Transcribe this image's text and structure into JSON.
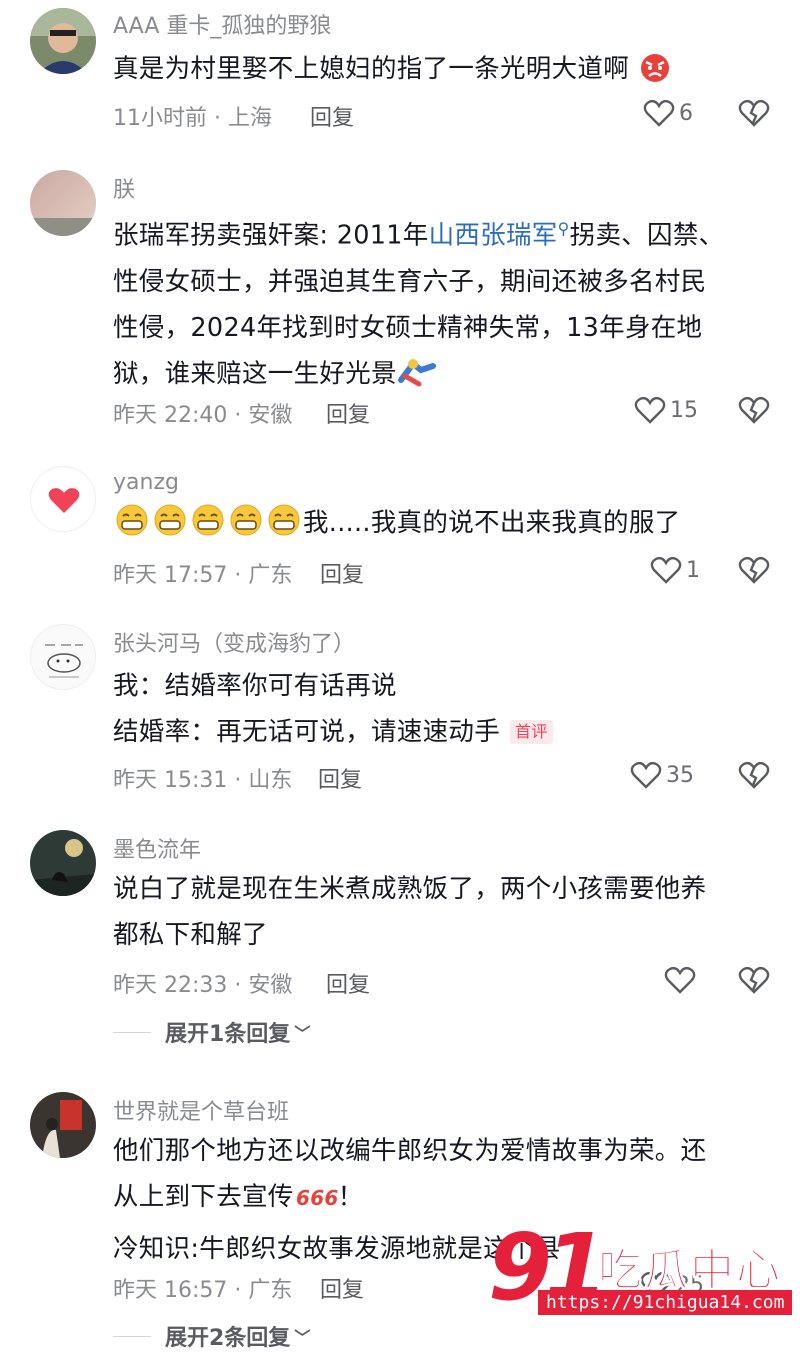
{
  "comments": [
    {
      "username": "AAA 重卡_孤独的野狼",
      "lines": [
        "真是为村里娶不上媳妇的指了一条光明大道啊"
      ],
      "time": "11小时前 · 上海",
      "reply_label": "回复",
      "likes": "6"
    },
    {
      "username": "朕",
      "lines_prefix": "张瑞军拐卖强奸案: 2011年",
      "link_text": "山西张瑞军",
      "lines_suffix": "拐卖、囚禁、",
      "line2": "性侵女硕士，并强迫其生育六子，期间还被多名村民",
      "line3": "性侵，2024年找到时女硕士精神失常，13年身在地",
      "line4": "狱，谁来赔这一生好光景",
      "time": "昨天 22:40 · 安徽",
      "reply_label": "回复",
      "likes": "15"
    },
    {
      "username": "yanzg",
      "text": "我.....我真的说不出来我真的服了",
      "time": "昨天 17:57 · 广东",
      "reply_label": "回复",
      "likes": "1"
    },
    {
      "username": "张头河马（变成海豹了）",
      "line1": "我：结婚率你可有话再说",
      "line2": "结婚率：再无话可说，请速速动手",
      "badge": "首评",
      "time": "昨天 15:31 · 山东",
      "reply_label": "回复",
      "likes": "35"
    },
    {
      "username": "墨色流年",
      "line1": "说白了就是现在生米煮成熟饭了，两个小孩需要他养",
      "line2": "都私下和解了",
      "time": "昨天 22:33 · 安徽",
      "reply_label": "回复",
      "likes": "",
      "expand": "展开1条回复"
    },
    {
      "username": "世界就是个草台班",
      "line1": "他们那个地方还以改编牛郎织女为爱情故事为荣。还",
      "line2": "从上到下去宣传",
      "line2_end": "！",
      "line3": "冷知识:牛郎织女故事发源地就是这个县",
      "time": "昨天 16:57 · 广东",
      "reply_label": "回复",
      "likes": "25",
      "expand": "展开2条回复"
    }
  ],
  "watermark": {
    "number": "91",
    "title": "吃瓜中心",
    "url": "https://91chigua14.com"
  },
  "colors": {
    "link": "#2d6dbd",
    "muted": "#8a8b91",
    "badge": "#e8455d",
    "watermark": "#e5203a"
  }
}
